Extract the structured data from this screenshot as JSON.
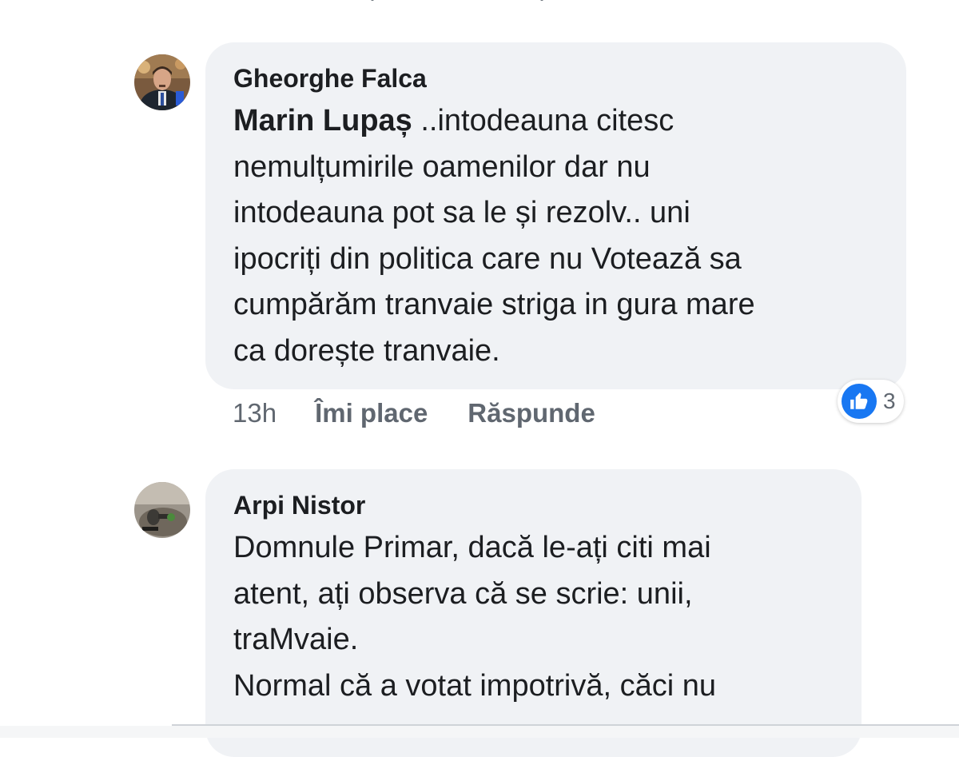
{
  "comments": [
    {
      "author": "Gheorghe Falca",
      "mention": "Marin Lupaș",
      "text_line1_rest": " ..intodeauna citesc",
      "text_lines": [
        "nemulțumirile oamenilor dar nu",
        "intodeauna pot sa le și rezolv.. uni",
        "ipocriți din politica care nu Votează sa",
        "cumpărăm tranvaie striga in gura mare",
        "ca dorește tranvaie."
      ],
      "time": "13h",
      "like_label": "Îmi place",
      "reply_label": "Răspunde",
      "reaction_icon": "like-icon",
      "reaction_count": "3"
    },
    {
      "author": "Arpi Nistor",
      "text_lines": [
        "Domnule Primar, dacă le-ați citi mai",
        "atent, ați observa că se scrie: unii,",
        "traMvaie.",
        "Normal că a votat impotrivă, căci nu"
      ]
    }
  ],
  "colors": {
    "bubble_bg": "#f0f2f5",
    "meta_text": "#606770",
    "like_blue": "#1877f2"
  }
}
